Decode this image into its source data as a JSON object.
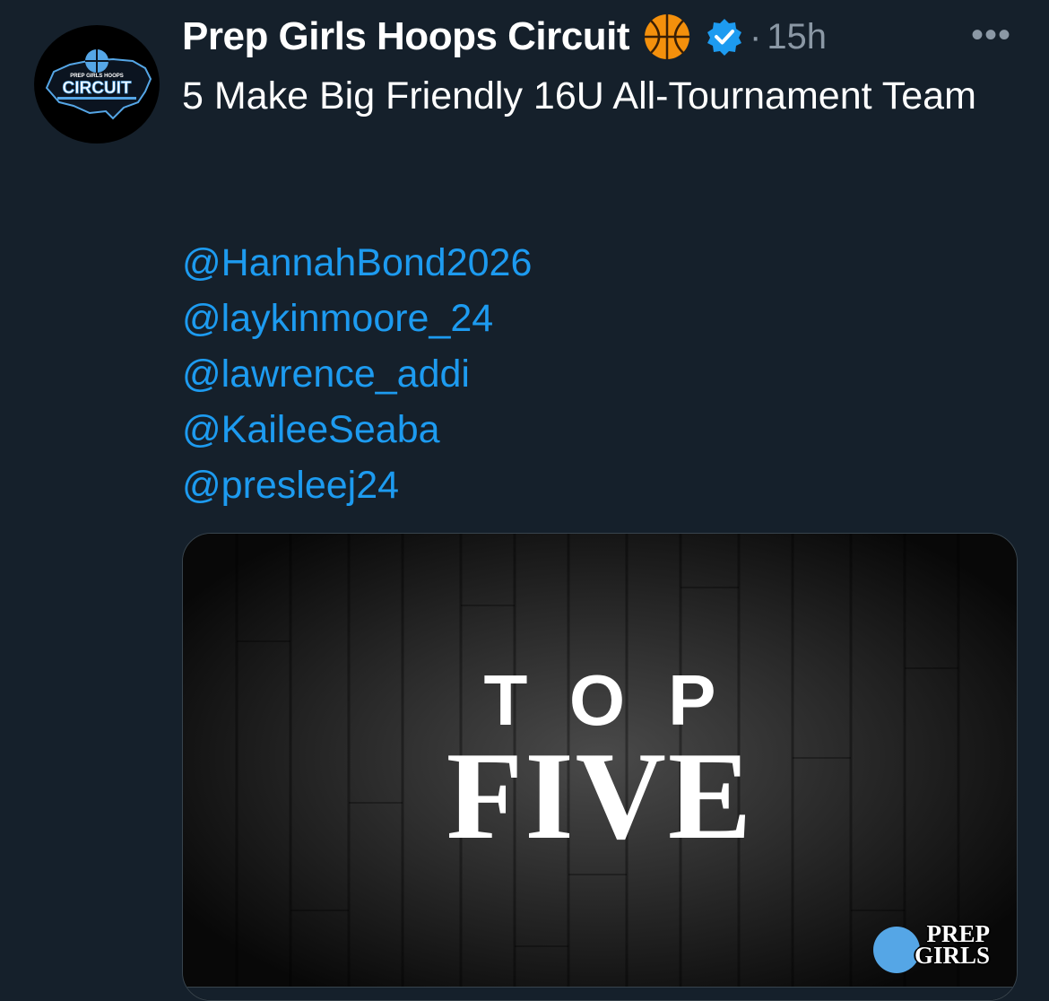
{
  "post": {
    "avatar": {
      "logo_top_text": "PREP GIRLS HOOPS",
      "logo_main_text": "CIRCUIT"
    },
    "display_name": "Prep Girls Hoops Circuit",
    "emoji_icon": "basketball-icon",
    "verified_icon": "verified-badge-icon",
    "dot": "·",
    "timestamp": "15h",
    "more_icon": "•••",
    "text": "5 Make Big Friendly 16U All-Tournament Team",
    "mentions": [
      "@HannahBond2026",
      "@laykinmoore_24",
      "@lawrence_addi",
      "@KaileeSeaba",
      "@presleej24"
    ],
    "media": {
      "line1": "TOP",
      "line2": "FIVE",
      "brand_line1": "PREP",
      "brand_line2": "GIRLS"
    }
  },
  "colors": {
    "background": "#15202b",
    "text": "#ffffff",
    "secondary": "#8b98a5",
    "link": "#1d9bf0",
    "verified": "#1d9bf0",
    "logo_accent": "#55a6e6"
  }
}
